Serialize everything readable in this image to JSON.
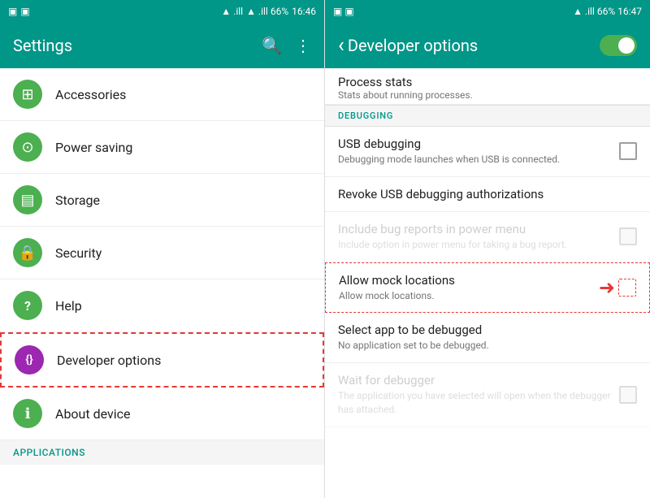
{
  "left": {
    "statusBar": {
      "leftIcons": "▣ ▣",
      "time": "16:46",
      "rightIcons": "▲ .ill 66%"
    },
    "toolbar": {
      "title": "Settings",
      "searchIcon": "🔍",
      "moreIcon": "⋮"
    },
    "items": [
      {
        "id": "accessories",
        "label": "Accessories",
        "icon": "⊞",
        "iconClass": "icon-green"
      },
      {
        "id": "power-saving",
        "label": "Power saving",
        "icon": "⊙",
        "iconClass": "icon-green"
      },
      {
        "id": "storage",
        "label": "Storage",
        "icon": "☰",
        "iconClass": "icon-green"
      },
      {
        "id": "security",
        "label": "Security",
        "icon": "🔒",
        "iconClass": "icon-green"
      },
      {
        "id": "help",
        "label": "Help",
        "icon": "?",
        "iconClass": "icon-green"
      },
      {
        "id": "developer-options",
        "label": "Developer options",
        "icon": "{}",
        "iconClass": "icon-purple",
        "highlighted": true
      },
      {
        "id": "about-device",
        "label": "About device",
        "icon": "ℹ",
        "iconClass": "icon-green"
      }
    ],
    "sectionHeader": "APPLICATIONS"
  },
  "right": {
    "statusBar": {
      "leftIcons": "▣ ▣",
      "time": "16:47",
      "rightIcons": "▲ .ill 66%"
    },
    "toolbar": {
      "backLabel": "‹",
      "title": "Developer options",
      "toggleOn": true
    },
    "processStats": {
      "title": "Process stats",
      "subtitle": "Stats about running processes."
    },
    "debuggingHeader": "DEBUGGING",
    "items": [
      {
        "id": "usb-debugging",
        "title": "USB debugging",
        "subtitle": "Debugging mode launches when USB is connected.",
        "hasCheckbox": true,
        "checked": false,
        "disabled": false
      },
      {
        "id": "revoke-usb",
        "title": "Revoke USB debugging authorizations",
        "subtitle": "",
        "hasCheckbox": false,
        "disabled": false
      },
      {
        "id": "bug-reports",
        "title": "Include bug reports in power menu",
        "subtitle": "Include option in power menu for taking a bug report.",
        "hasCheckbox": true,
        "checked": false,
        "disabled": true
      },
      {
        "id": "mock-locations",
        "title": "Allow mock locations",
        "subtitle": "Allow mock locations.",
        "hasCheckbox": true,
        "checked": false,
        "disabled": false,
        "highlighted": true,
        "hasArrow": true
      },
      {
        "id": "select-debug-app",
        "title": "Select app to be debugged",
        "subtitle": "No application set to be debugged.",
        "hasCheckbox": false,
        "disabled": false
      },
      {
        "id": "wait-debugger",
        "title": "Wait for debugger",
        "subtitle": "The application you have selected will open when the debugger has attached.",
        "hasCheckbox": true,
        "checked": false,
        "disabled": true
      }
    ]
  }
}
